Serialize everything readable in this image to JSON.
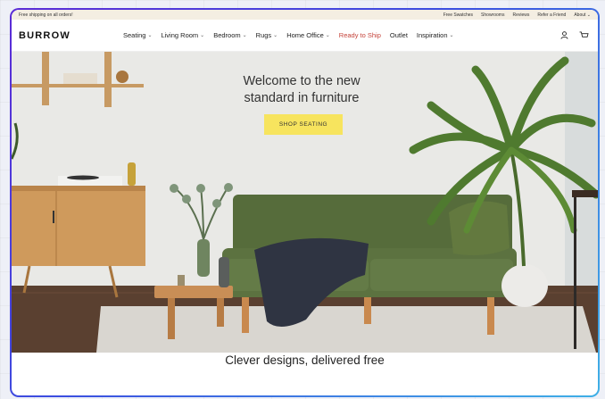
{
  "announcement": {
    "text": "Free shipping on all orders!"
  },
  "utility_links": [
    "Free Swatches",
    "Showrooms",
    "Reviews",
    "Refer a Friend",
    "About"
  ],
  "utility_about_chevron": "⌄",
  "brand": {
    "logo": "BURROW"
  },
  "nav": {
    "items": [
      {
        "label": "Seating",
        "dropdown": true
      },
      {
        "label": "Living Room",
        "dropdown": true
      },
      {
        "label": "Bedroom",
        "dropdown": true
      },
      {
        "label": "Rugs",
        "dropdown": true
      },
      {
        "label": "Home Office",
        "dropdown": true
      },
      {
        "label": "Ready to Ship",
        "dropdown": false,
        "accent": "#c5433a"
      },
      {
        "label": "Outlet",
        "dropdown": false
      },
      {
        "label": "Inspiration",
        "dropdown": true
      }
    ],
    "chevron": "⌄",
    "icons": [
      "user-icon",
      "cart-icon"
    ]
  },
  "hero": {
    "heading_line1": "Welcome to the new",
    "heading_line2": "standard in furniture",
    "cta_label": "SHOP SEATING",
    "cta_color": "#f7e45e",
    "sofa_color": "#5c7240"
  },
  "section": {
    "heading": "Clever designs, delivered free"
  }
}
